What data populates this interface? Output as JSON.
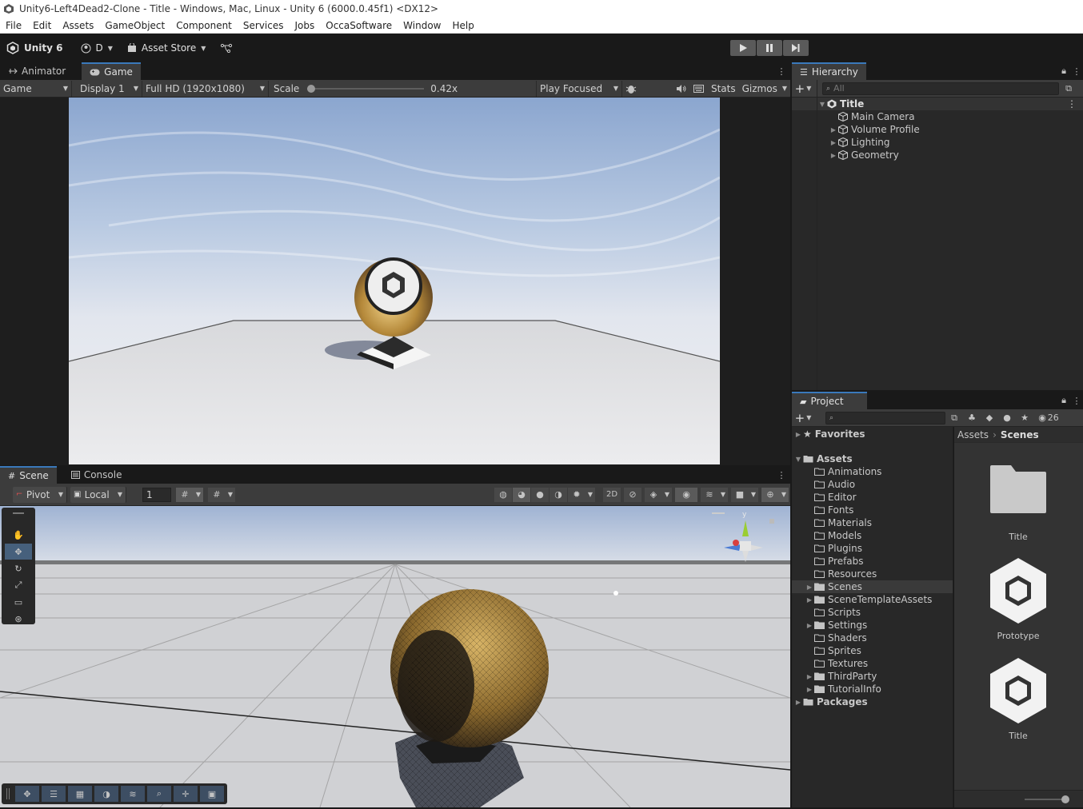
{
  "window": {
    "title": "Unity6-Left4Dead2-Clone - Title - Windows, Mac, Linux - Unity 6 (6000.0.45f1) <DX12>"
  },
  "menu": [
    "File",
    "Edit",
    "Assets",
    "GameObject",
    "Component",
    "Services",
    "Jobs",
    "OccaSoftware",
    "Window",
    "Help"
  ],
  "toolbar": {
    "unity_label": "Unity 6",
    "account_label": "D",
    "asset_store_label": "Asset Store"
  },
  "game_panel": {
    "tabs": [
      {
        "label": "Animator"
      },
      {
        "label": "Game"
      }
    ],
    "view_mode": "Game",
    "display": "Display 1",
    "resolution": "Full HD (1920x1080)",
    "scale_label": "Scale",
    "scale_value": "0.42x",
    "play_mode": "Play Focused",
    "stats_label": "Stats",
    "gizmos_label": "Gizmos"
  },
  "scene_panel": {
    "tabs": [
      {
        "label": "Scene"
      },
      {
        "label": "Console"
      }
    ],
    "pivot_label": "Pivot",
    "local_label": "Local",
    "grid_value": "1",
    "gizmo_axis_y": "y"
  },
  "hierarchy": {
    "tab_label": "Hierarchy",
    "search_placeholder": "All",
    "scene_name": "Title",
    "items": [
      {
        "label": "Main Camera",
        "expandable": false
      },
      {
        "label": "Volume Profile",
        "expandable": true
      },
      {
        "label": "Lighting",
        "expandable": true
      },
      {
        "label": "Geometry",
        "expandable": true
      }
    ]
  },
  "project": {
    "tab_label": "Project",
    "hidden_count": "26",
    "favorites_label": "Favorites",
    "assets_label": "Assets",
    "packages_label": "Packages",
    "breadcrumb": [
      "Assets",
      "Scenes"
    ],
    "folders": [
      {
        "label": "Animations",
        "expandable": false
      },
      {
        "label": "Audio",
        "expandable": false
      },
      {
        "label": "Editor",
        "expandable": false
      },
      {
        "label": "Fonts",
        "expandable": false
      },
      {
        "label": "Materials",
        "expandable": false
      },
      {
        "label": "Models",
        "expandable": false
      },
      {
        "label": "Plugins",
        "expandable": false
      },
      {
        "label": "Prefabs",
        "expandable": false
      },
      {
        "label": "Resources",
        "expandable": false
      },
      {
        "label": "Scenes",
        "expandable": true,
        "selected": true
      },
      {
        "label": "SceneTemplateAssets",
        "expandable": true
      },
      {
        "label": "Scripts",
        "expandable": false
      },
      {
        "label": "Settings",
        "expandable": true
      },
      {
        "label": "Shaders",
        "expandable": false
      },
      {
        "label": "Sprites",
        "expandable": false
      },
      {
        "label": "Textures",
        "expandable": false
      },
      {
        "label": "ThirdParty",
        "expandable": true
      },
      {
        "label": "TutorialInfo",
        "expandable": true
      }
    ],
    "grid_items": [
      {
        "label": "Title",
        "kind": "folder-icon"
      },
      {
        "label": "Prototype",
        "kind": "unity-scene-icon"
      },
      {
        "label": "Title",
        "kind": "unity-scene-icon"
      }
    ]
  }
}
